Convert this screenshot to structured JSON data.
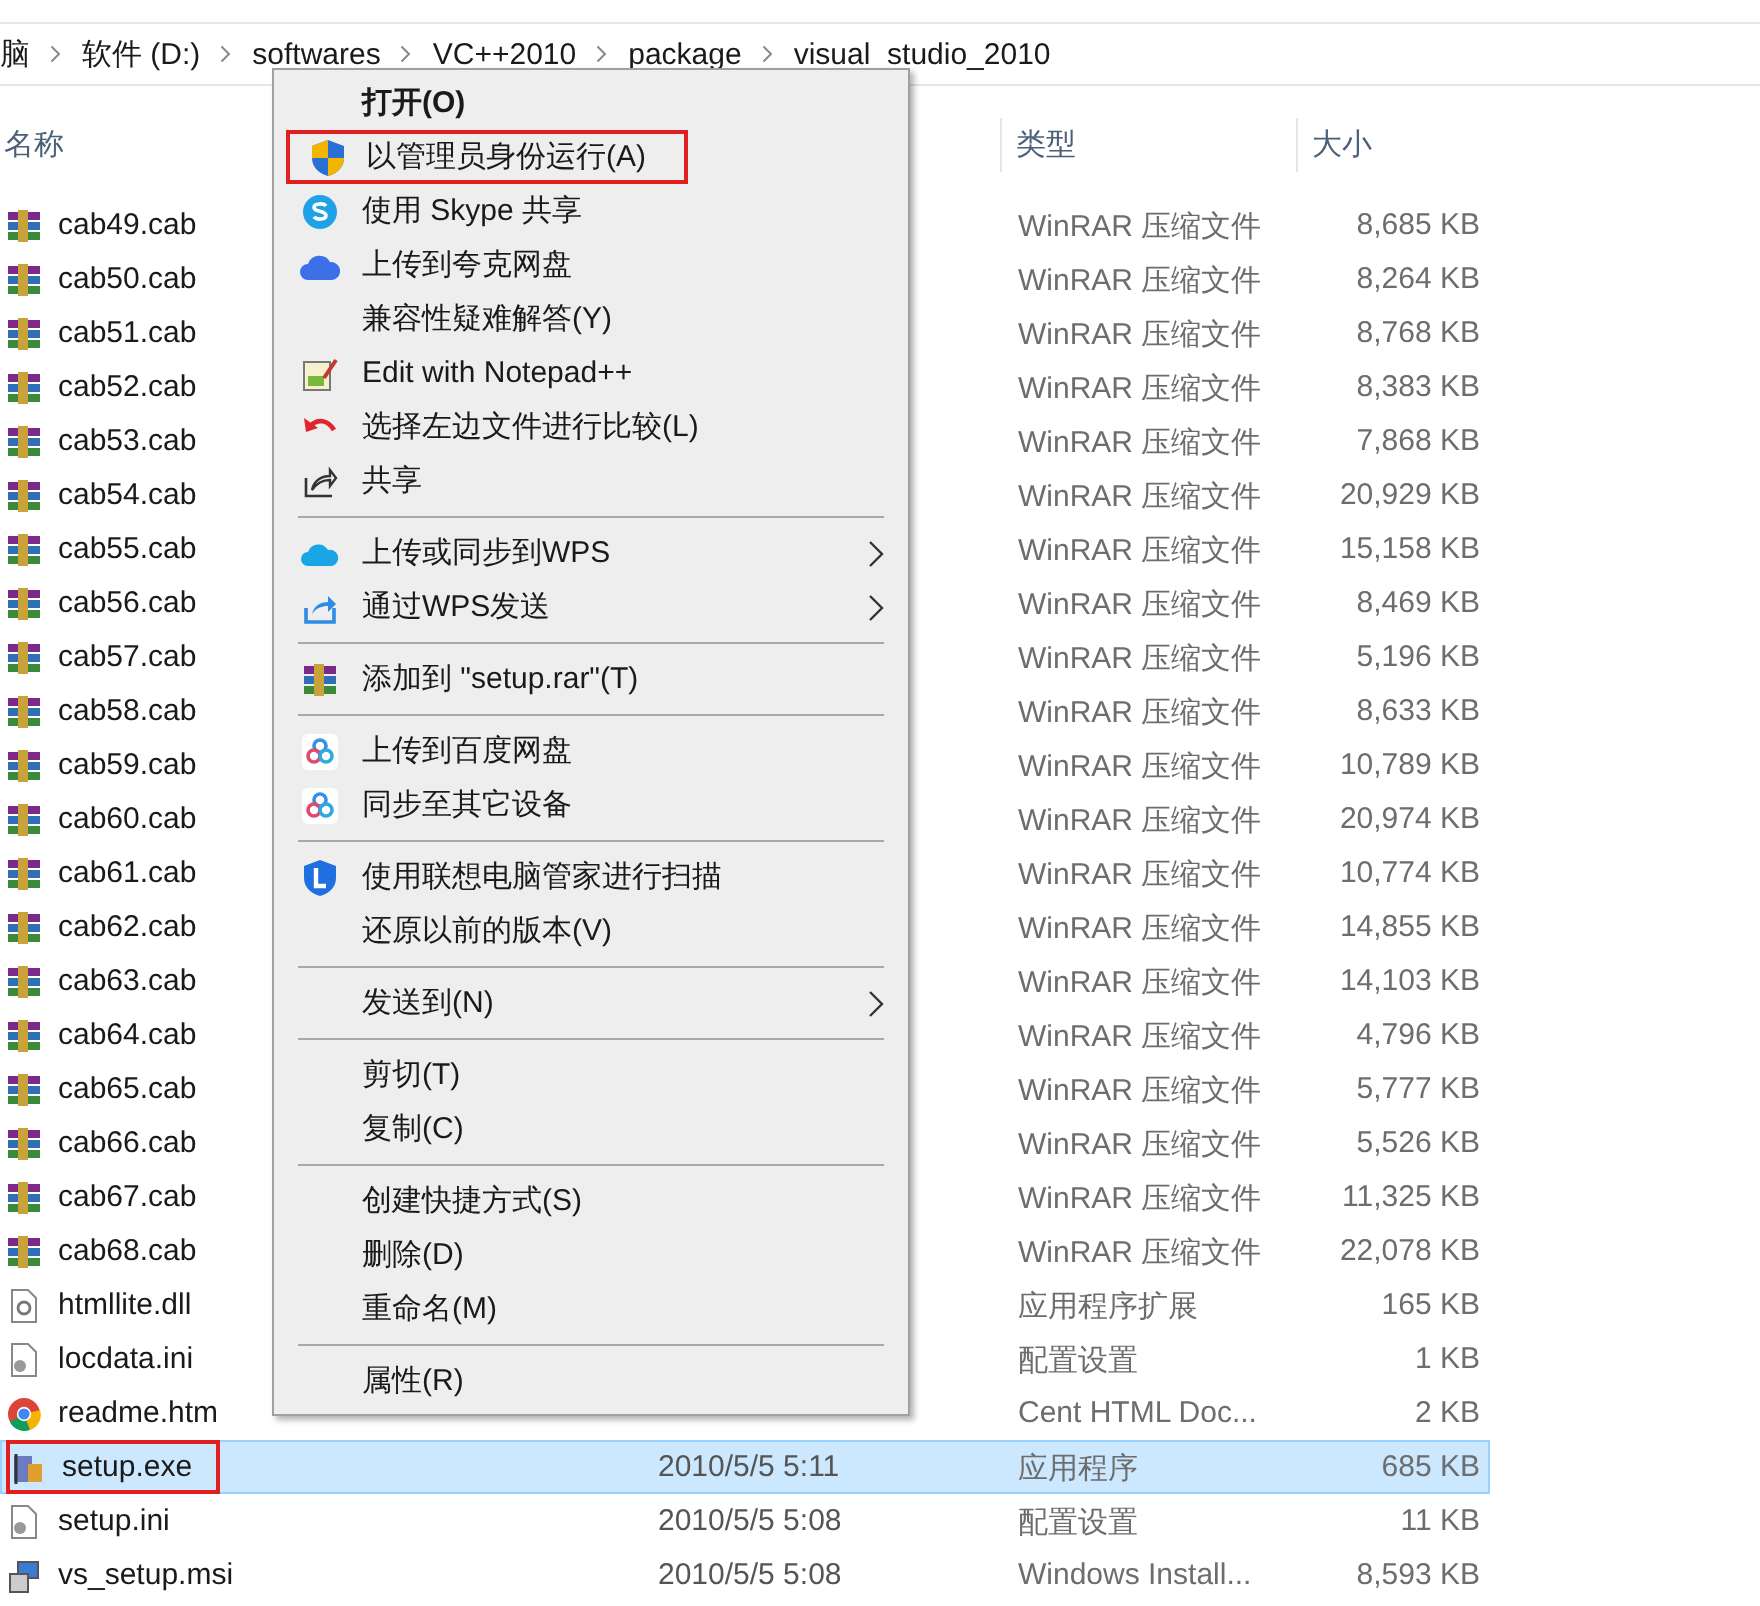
{
  "breadcrumb": [
    "脑",
    "软件 (D:)",
    "softwares",
    "VC++2010",
    "package",
    "visual_studio_2010"
  ],
  "columns": [
    "名称",
    "类型",
    "大小"
  ],
  "files": [
    {
      "kind": "archive",
      "name": "cab49.cab",
      "type": "WinRAR 压缩文件",
      "size": "8,685 KB",
      "selected": false
    },
    {
      "kind": "archive",
      "name": "cab50.cab",
      "type": "WinRAR 压缩文件",
      "size": "8,264 KB",
      "selected": false
    },
    {
      "kind": "archive",
      "name": "cab51.cab",
      "type": "WinRAR 压缩文件",
      "size": "8,768 KB",
      "selected": false
    },
    {
      "kind": "archive",
      "name": "cab52.cab",
      "type": "WinRAR 压缩文件",
      "size": "8,383 KB",
      "selected": false
    },
    {
      "kind": "archive",
      "name": "cab53.cab",
      "type": "WinRAR 压缩文件",
      "size": "7,868 KB",
      "selected": false
    },
    {
      "kind": "archive",
      "name": "cab54.cab",
      "type": "WinRAR 压缩文件",
      "size": "20,929 KB",
      "selected": false
    },
    {
      "kind": "archive",
      "name": "cab55.cab",
      "type": "WinRAR 压缩文件",
      "size": "15,158 KB",
      "selected": false
    },
    {
      "kind": "archive",
      "name": "cab56.cab",
      "type": "WinRAR 压缩文件",
      "size": "8,469 KB",
      "selected": false
    },
    {
      "kind": "archive",
      "name": "cab57.cab",
      "type": "WinRAR 压缩文件",
      "size": "5,196 KB",
      "selected": false
    },
    {
      "kind": "archive",
      "name": "cab58.cab",
      "type": "WinRAR 压缩文件",
      "size": "8,633 KB",
      "selected": false
    },
    {
      "kind": "archive",
      "name": "cab59.cab",
      "type": "WinRAR 压缩文件",
      "size": "10,789 KB",
      "selected": false
    },
    {
      "kind": "archive",
      "name": "cab60.cab",
      "type": "WinRAR 压缩文件",
      "size": "20,974 KB",
      "selected": false
    },
    {
      "kind": "archive",
      "name": "cab61.cab",
      "type": "WinRAR 压缩文件",
      "size": "10,774 KB",
      "selected": false
    },
    {
      "kind": "archive",
      "name": "cab62.cab",
      "type": "WinRAR 压缩文件",
      "size": "14,855 KB",
      "selected": false
    },
    {
      "kind": "archive",
      "name": "cab63.cab",
      "type": "WinRAR 压缩文件",
      "size": "14,103 KB",
      "selected": false
    },
    {
      "kind": "archive",
      "name": "cab64.cab",
      "type": "WinRAR 压缩文件",
      "size": "4,796 KB",
      "selected": false
    },
    {
      "kind": "archive",
      "name": "cab65.cab",
      "type": "WinRAR 压缩文件",
      "size": "5,777 KB",
      "selected": false
    },
    {
      "kind": "archive",
      "name": "cab66.cab",
      "type": "WinRAR 压缩文件",
      "size": "5,526 KB",
      "selected": false
    },
    {
      "kind": "archive",
      "name": "cab67.cab",
      "type": "WinRAR 压缩文件",
      "size": "11,325 KB",
      "selected": false
    },
    {
      "kind": "archive",
      "name": "cab68.cab",
      "type": "WinRAR 压缩文件",
      "size": "22,078 KB",
      "selected": false
    },
    {
      "kind": "dll",
      "name": "htmllite.dll",
      "type": "应用程序扩展",
      "size": "165 KB",
      "selected": false
    },
    {
      "kind": "ini",
      "name": "locdata.ini",
      "type": "配置设置",
      "size": "1 KB",
      "selected": false
    },
    {
      "kind": "htm",
      "name": "readme.htm",
      "type": "Cent HTML Doc...",
      "size": "2 KB",
      "selected": false
    },
    {
      "kind": "exe",
      "name": "setup.exe",
      "date": "2010/5/5 5:11",
      "type": "应用程序",
      "size": "685 KB",
      "selected": true,
      "highlighted": true
    },
    {
      "kind": "ini",
      "name": "setup.ini",
      "date": "2010/5/5 5:08",
      "type": "配置设置",
      "size": "11 KB",
      "selected": false
    },
    {
      "kind": "msi",
      "name": "vs_setup.msi",
      "date": "2010/5/5 5:08",
      "type": "Windows Install...",
      "size": "8,593 KB",
      "selected": false
    }
  ],
  "context_menu": [
    [
      {
        "kind": "plain",
        "label": "打开(O)",
        "default": true
      },
      {
        "kind": "shield",
        "label": "以管理员身份运行(A)",
        "highlighted": true
      },
      {
        "kind": "skype",
        "label": "使用 Skype 共享"
      },
      {
        "kind": "cloud",
        "label": "上传到夸克网盘"
      },
      {
        "kind": "plain",
        "label": "兼容性疑难解答(Y)"
      },
      {
        "kind": "notepad",
        "label": "Edit with Notepad++"
      },
      {
        "kind": "undo",
        "label": "选择左边文件进行比较(L)"
      },
      {
        "kind": "share",
        "label": "共享"
      }
    ],
    [
      {
        "kind": "wpscloud",
        "label": "上传或同步到WPS",
        "submenu": true
      },
      {
        "kind": "wpssend",
        "label": "通过WPS发送",
        "submenu": true
      }
    ],
    [
      {
        "kind": "winrar",
        "label": "添加到 \"setup.rar\"(T)"
      }
    ],
    [
      {
        "kind": "baidu",
        "label": "上传到百度网盘"
      },
      {
        "kind": "baidu",
        "label": "同步至其它设备"
      }
    ],
    [
      {
        "kind": "lenovo",
        "label": "使用联想电脑管家进行扫描"
      },
      {
        "kind": "plain",
        "label": "还原以前的版本(V)"
      }
    ],
    [
      {
        "kind": "plain",
        "label": "发送到(N)",
        "submenu": true
      }
    ],
    [
      {
        "kind": "plain",
        "label": "剪切(T)"
      },
      {
        "kind": "plain",
        "label": "复制(C)"
      }
    ],
    [
      {
        "kind": "plain",
        "label": "创建快捷方式(S)"
      },
      {
        "kind": "plain",
        "label": "删除(D)"
      },
      {
        "kind": "plain",
        "label": "重命名(M)"
      }
    ],
    [
      {
        "kind": "plain",
        "label": "属性(R)"
      }
    ]
  ]
}
